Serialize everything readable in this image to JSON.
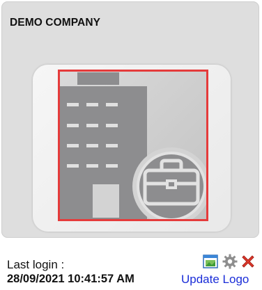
{
  "company": {
    "name": "DEMO COMPANY"
  },
  "login": {
    "label": "Last login :",
    "timestamp": "28/09/2021 10:41:57 AM"
  },
  "actions": {
    "update_logo_label": "Update Logo",
    "icons": [
      "window-image-icon",
      "gear-icon",
      "close-x-icon"
    ]
  },
  "colors": {
    "card_bg": "#dedede",
    "highlight_border": "#e53b3b",
    "link": "#1a2dd8",
    "building": "#8d8d8f"
  }
}
